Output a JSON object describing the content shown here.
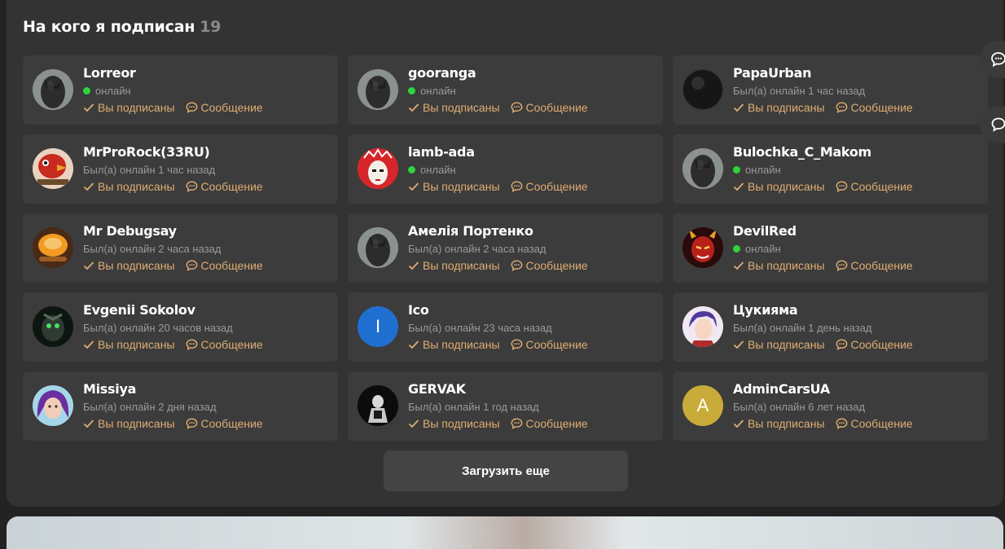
{
  "section": {
    "title": "На кого я подписан",
    "count": "19"
  },
  "labels": {
    "subscribed": "Вы подписаны",
    "message": "Сообщение"
  },
  "load_more": "Загрузить еще",
  "colors": {
    "accent": "#e0ad73",
    "online": "#2fd43a",
    "card": "#3c3c3c",
    "panel": "#333333"
  },
  "users": [
    {
      "name": "Lorreor",
      "status": "онлайн",
      "online": true,
      "avatar": "default-silhouette"
    },
    {
      "name": "gooranga",
      "status": "онлайн",
      "online": true,
      "avatar": "default-silhouette"
    },
    {
      "name": "PapaUrban",
      "status": "Был(а) онлайн 1 час назад",
      "online": false,
      "avatar": "dark-orb"
    },
    {
      "name": "MrProRock(33RU)",
      "status": "Был(а) онлайн 1 час назад",
      "online": false,
      "avatar": "red-bird"
    },
    {
      "name": "lamb-ada",
      "status": "онлайн",
      "online": true,
      "avatar": "masked-face"
    },
    {
      "name": "Bulochka_C_Makom",
      "status": "онлайн",
      "online": true,
      "avatar": "default-silhouette"
    },
    {
      "name": "Mr Debugsay",
      "status": "Был(а) онлайн 2 часа назад",
      "online": false,
      "avatar": "orange-cup"
    },
    {
      "name": "Амелія Портенко",
      "status": "Был(а) онлайн 2 часа назад",
      "online": false,
      "avatar": "default-silhouette"
    },
    {
      "name": "DevilRed",
      "status": "онлайн",
      "online": true,
      "avatar": "red-devil"
    },
    {
      "name": "Evgenii Sokolov",
      "status": "Был(а) онлайн 20 часов назад",
      "online": false,
      "avatar": "green-robot"
    },
    {
      "name": "Ico",
      "status": "Был(а) онлайн 23 часа назад",
      "online": false,
      "avatar": "letter",
      "letter": "I",
      "avatar_color": "#1f6fd0"
    },
    {
      "name": "Цукияма",
      "status": "Был(а) онлайн 1 день назад",
      "online": false,
      "avatar": "anime-portrait"
    },
    {
      "name": "Missiya",
      "status": "Был(а) онлайн 2 дня назад",
      "online": false,
      "avatar": "purple-hair-girl"
    },
    {
      "name": "GERVAK",
      "status": "Был(а) онлайн 1 год назад",
      "online": false,
      "avatar": "dark-figure"
    },
    {
      "name": "AdminCarsUA",
      "status": "Был(а) онлайн 6 лет назад",
      "online": false,
      "avatar": "letter",
      "letter": "A",
      "avatar_color": "#c9ab3a"
    }
  ]
}
